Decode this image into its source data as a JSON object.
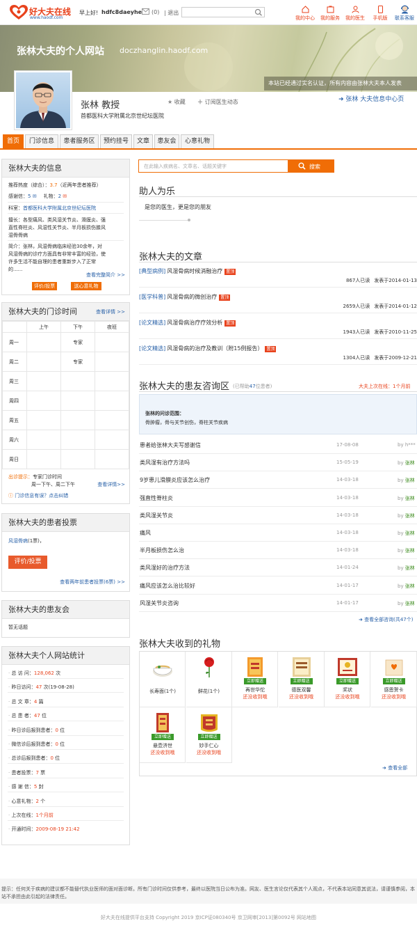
{
  "topbar": {
    "logo_text": "好大夫在线",
    "logo_url": "www.haodf.com",
    "greeting": "早上好!",
    "username": "hdfc8daeyhe",
    "mail_count": "(0)",
    "logout": "| 退出",
    "nav": [
      {
        "label": "我的中心",
        "icon": "home-icon"
      },
      {
        "label": "我的服务",
        "icon": "service-icon"
      },
      {
        "label": "我的医生",
        "icon": "doctor-icon"
      },
      {
        "label": "手机版",
        "icon": "mobile-icon"
      }
    ],
    "kefu": "联系客服"
  },
  "banner": {
    "title": "张林大夫的个人网站",
    "url": "doczhanglin.haodf.com",
    "verify": "本站已经通过实名认证，所有内容由张林大夫本人发表"
  },
  "profile": {
    "name": "张林  教授",
    "hospital": "首都医科大学附属北京世纪坛医院",
    "favorite": "收藏",
    "subscribe": "订阅医生动态",
    "center_link": "张林 大夫信息中心页"
  },
  "tabs": [
    "首页",
    "门诊信息",
    "患者服务区",
    "预约挂号",
    "文章",
    "患友会",
    "心意礼物"
  ],
  "info_box": {
    "title": "张林大夫的信息",
    "hot_label": "推荐热度（综合）：",
    "hot_value": "3.7",
    "hot_note": "（近两年患者推荐）",
    "thanks_label": "感谢信：",
    "thanks_value": "5",
    "gift_label": "礼物：",
    "gift_value": "2",
    "dept_label": "科室：",
    "dept_value": "首都医科大学附属北京世纪坛医院",
    "skill_label": "擅长：",
    "skill_value": "各型痛风、类风湿关节炎、滑膜炎、强直性脊柱炎、风湿性关节炎、半月板损伤膝风湿骨骨病",
    "intro_label": "简介：",
    "intro_value": "张林，风湿骨病临床经验30余年，对风湿骨病的诊疗方面具有非常丰富的经验，使许多生活不能自理的患者重新步入了正常的......",
    "more": "查看完整简介 >>",
    "btn_vote": "评价/投票",
    "btn_gift": "送心意礼物"
  },
  "schedule": {
    "title": "张林大夫的门诊时间",
    "more": "查看详情 >>",
    "headers": [
      "",
      "上午",
      "下午",
      "夜班"
    ],
    "rows": [
      {
        "day": "周一",
        "am": "",
        "pm": "专家",
        "night": ""
      },
      {
        "day": "周二",
        "am": "",
        "pm": "专家",
        "night": ""
      },
      {
        "day": "周三",
        "am": "",
        "pm": "",
        "night": ""
      },
      {
        "day": "周四",
        "am": "",
        "pm": "",
        "night": ""
      },
      {
        "day": "周五",
        "am": "",
        "pm": "",
        "night": ""
      },
      {
        "day": "周六",
        "am": "",
        "pm": "",
        "night": ""
      },
      {
        "day": "周日",
        "am": "",
        "pm": "",
        "night": ""
      }
    ],
    "note_label": "出诊提示：",
    "note_line1": "专家门诊时间",
    "note_line2": "周一下午、周二下午",
    "note_more": "查看详情>>",
    "wrong_info": "门诊信息有误？点击纠错"
  },
  "vote_box": {
    "title": "张林大夫的患者投票",
    "disease": "风湿骨病",
    "count": "(1票)，",
    "btn": "评价/投票",
    "more": "查看两年前患者投票(6票) >>"
  },
  "club_box": {
    "title": "张林大夫的患友会",
    "empty": "暂无话题"
  },
  "stats_box": {
    "title": "张林大夫个人网站统计",
    "items": [
      {
        "label": "总 访 问：",
        "value": "128,062",
        "unit": " 次"
      },
      {
        "label": "昨日访问：",
        "value": "47",
        "unit": " 次(19-08-28)"
      },
      {
        "label": "总 文 章：",
        "value": "4",
        "unit": " 篇"
      },
      {
        "label": "总 患 者：",
        "value": "47",
        "unit": " 位"
      },
      {
        "label": "昨日诊后报到患者：",
        "value": "0",
        "unit": " 位"
      },
      {
        "label": "微信诊后报到患者：",
        "value": "0",
        "unit": " 位"
      },
      {
        "label": "总诊后报到患者：",
        "value": "0",
        "unit": " 位"
      },
      {
        "label": "患者投票：",
        "value": "7",
        "unit": " 票"
      },
      {
        "label": "感 谢 信：",
        "value": "5",
        "unit": " 封"
      },
      {
        "label": "心意礼物：",
        "value": "2",
        "unit": " 个"
      },
      {
        "label": "上次在线：",
        "value": "1个月前",
        "unit": ""
      },
      {
        "label": "开通时间：",
        "value": "2009-08-19 21:42",
        "unit": ""
      }
    ]
  },
  "main_search": {
    "placeholder": "在此输入疾病名、文章名、话题关键字",
    "btn": "搜索"
  },
  "helper": {
    "title": "助人为乐",
    "text": "是您的医生，更是您的朋友"
  },
  "articles": {
    "title": "张林大夫的文章",
    "hot": "置顶",
    "items": [
      {
        "tag": "[典型病例]",
        "title": "风湿骨病时候消融治疗",
        "reads": "867人已读",
        "date": "发表于2014-01-13"
      },
      {
        "tag": "[医学科普]",
        "title": "风湿骨病的微创治疗",
        "reads": "2659人已读",
        "date": "发表于2014-01-12"
      },
      {
        "tag": "[论文精选]",
        "title": "风湿骨病治疗疗效分析",
        "reads": "1943人已读",
        "date": "发表于2010-11-25"
      },
      {
        "tag": "[论文精选]",
        "title": "风湿骨病的治疗及教训（附15例报告）",
        "reads": "1304人已读",
        "date": "发表于2009-12-21"
      }
    ]
  },
  "consult": {
    "title": "张林大夫的患友咨询区",
    "helped_prefix": "(已帮助",
    "helped_count": "47",
    "helped_suffix": "位患者)",
    "last_online": "大夫上次在线：",
    "last_online_value": "1个月前",
    "scope_label": "张林的问诊范围：",
    "scope_text": "骨肿瘤，骨与关节创伤，脊柱关节疾病",
    "items": [
      {
        "title": "患者给张林大夫写感谢信",
        "date": "17-08-08",
        "by": "by ",
        "who": "h***"
      },
      {
        "title": "类风湿有治疗方法吗",
        "date": "15-05-19",
        "by": "by ",
        "who": "张林"
      },
      {
        "title": "9岁患儿滑膜炎应该怎么治疗",
        "date": "14-03-18",
        "by": "by ",
        "who": "张林"
      },
      {
        "title": "强直性脊柱炎",
        "date": "14-03-18",
        "by": "by ",
        "who": "张林"
      },
      {
        "title": "类风湿关节炎",
        "date": "14-03-18",
        "by": "by ",
        "who": "张林"
      },
      {
        "title": "痛风",
        "date": "14-03-18",
        "by": "by ",
        "who": "张林"
      },
      {
        "title": "半月板损伤怎么治",
        "date": "14-03-18",
        "by": "by ",
        "who": "张林"
      },
      {
        "title": "类风湿好的治疗方法",
        "date": "14-01-24",
        "by": "by ",
        "who": "张林"
      },
      {
        "title": "痛风应该怎么治比较好",
        "date": "14-01-17",
        "by": "by ",
        "who": "张林"
      },
      {
        "title": "风湿关节炎咨询",
        "date": "14-01-17",
        "by": "by ",
        "who": "张林"
      }
    ],
    "more": "查看全部咨询(共47个)"
  },
  "gifts": {
    "title": "张林大夫收到的礼物",
    "btn": "立即赠送",
    "items": [
      {
        "name": "长寿面",
        "count": "(1个)",
        "type": "owned"
      },
      {
        "name": "鲜花",
        "count": "(1个)",
        "type": "owned"
      },
      {
        "name": "再世华佗",
        "sub": "还没收到哦",
        "type": "send"
      },
      {
        "name": "德医双馨",
        "sub": "还没收到哦",
        "type": "send"
      },
      {
        "name": "奖状",
        "sub": "还没收到哦",
        "type": "send"
      },
      {
        "name": "感恩贺卡",
        "sub": "还没收到哦",
        "type": "send"
      },
      {
        "name": "悬壶济世",
        "sub": "还没收到哦",
        "type": "send"
      },
      {
        "name": "妙手仁心",
        "sub": "还没收到哦",
        "type": "send"
      }
    ],
    "more": "查看全部"
  },
  "footer": {
    "note": "提示：任何关于疾病的建议都不能替代执业医师的面对面诊断。所有门诊时间仅供参考，最终以医院当日公布为准。网友、医生言论仅代表其个人观点，不代表本站同意其说法，请谨慎参阅，本站不承担由此引起的法律责任。",
    "copyright": "好大夫在线提供平台支持    Copyright 2019 京ICP证080340号 京卫网审[2013]第0092号 网站地图"
  },
  "colors": {
    "accent": "#f06d06",
    "link": "#2a62a8",
    "brand_red": "#e8421c",
    "green": "#3a8a1a"
  }
}
